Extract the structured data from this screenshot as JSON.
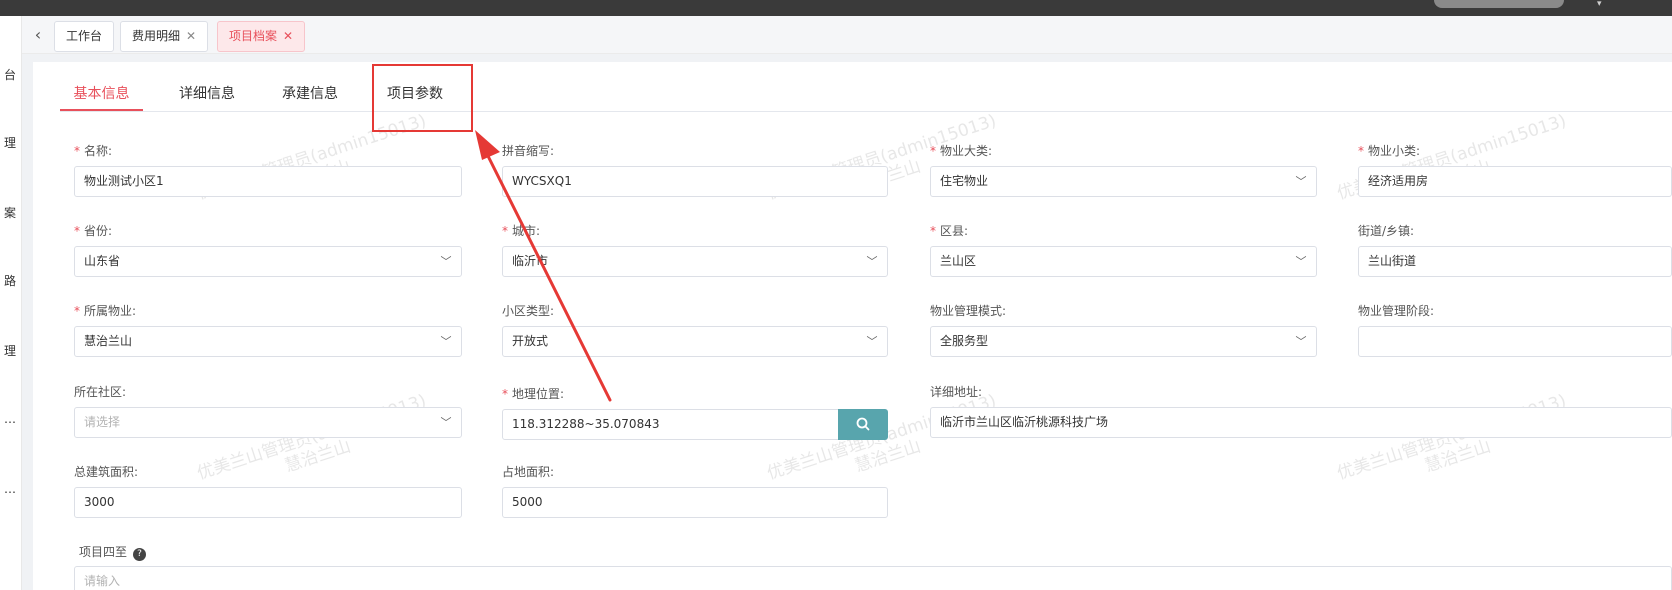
{
  "nav": {
    "items": [
      "台",
      "理",
      "案",
      "路",
      "理",
      "…",
      "…"
    ]
  },
  "tabs": {
    "workbench": "工作台",
    "expense": "费用明细",
    "project": "项目档案"
  },
  "form_tabs": {
    "basic": "基本信息",
    "detail": "详细信息",
    "build": "承建信息",
    "params": "项目参数"
  },
  "watermark": {
    "line1": "优美兰山管理员(admin15013)",
    "line2": "慧治兰山"
  },
  "fields": {
    "name": {
      "label": "名称:",
      "value": "物业测试小区1"
    },
    "pinyin": {
      "label": "拼音缩写:",
      "value": "WYCSXQ1"
    },
    "category": {
      "label": "物业大类:",
      "value": "住宅物业"
    },
    "subcategory": {
      "label": "物业小类:",
      "value": "经济适用房"
    },
    "province": {
      "label": "省份:",
      "value": "山东省"
    },
    "city": {
      "label": "城市:",
      "value": "临沂市"
    },
    "district": {
      "label": "区县:",
      "value": "兰山区"
    },
    "street": {
      "label": "街道/乡镇:",
      "value": "兰山街道"
    },
    "property": {
      "label": "所属物业:",
      "value": "慧治兰山"
    },
    "area_type": {
      "label": "小区类型:",
      "value": "开放式"
    },
    "mgmt_mode": {
      "label": "物业管理模式:",
      "value": "全服务型"
    },
    "mgmt_stage": {
      "label": "物业管理阶段:",
      "value": ""
    },
    "community": {
      "label": "所在社区:",
      "placeholder": "请选择"
    },
    "location": {
      "label": "地理位置:",
      "value": "118.312288~35.070843"
    },
    "address": {
      "label": "详细地址:",
      "value": "临沂市兰山区临沂桃源科技广场"
    },
    "building_area": {
      "label": "总建筑面积:",
      "value": "3000"
    },
    "land_area": {
      "label": "占地面积:",
      "value": "5000"
    },
    "boundary": {
      "label": "项目四至",
      "placeholder": "请输入"
    }
  },
  "colors": {
    "accent": "#e8505b",
    "search_button": "#58a5ad",
    "annotation": "#e53935"
  }
}
